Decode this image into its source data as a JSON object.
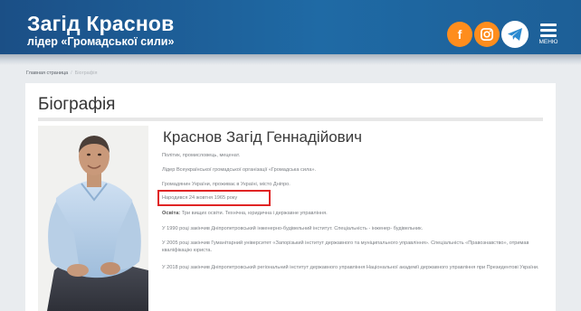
{
  "header": {
    "title": "Загід Краснов",
    "subtitle": "лідер «Громадської сили»",
    "social": {
      "facebook": "f"
    },
    "menu_label": "МЕНЮ"
  },
  "breadcrumb": {
    "home": "Главная страница",
    "separator": "/",
    "current": "Біографія"
  },
  "page": {
    "title": "Біографія",
    "person_name": "Краснов Загід Геннадійович",
    "paragraphs": {
      "p1": "Політик, промисловець, меценат.",
      "p2": "Лідер Всеукраїнської громадської організації «Громадська сила».",
      "p3": "Громадянин України, проживає в Україні, місто Дніпро.",
      "p4": "Народився 24 жовтня 1965 року",
      "p5_label": "Освіта:",
      "p5_text": " Три вищих освіти. Технічна, юридична і державне управління.",
      "p6": "У 1990 році закінчив Дніпропетровський інженерно-будівельний інститут. Спеціальність - інженер- будівельник.",
      "p7": "У 2005 році закінчив Гуманітарний університет «Запорізький інститут державного та муніципального управління». Спеціальність «Правознавство», отримав кваліфікацію юриста.",
      "p8": "У 2018 році закінчив Дніпропетровський регіональний інститут державного управління Національної академії державного управління при Президентові України."
    }
  },
  "colors": {
    "header_blue": "#1f6aa5",
    "social_orange": "#fe8d1d",
    "highlight_red": "#e02424"
  },
  "icons": {
    "facebook": "facebook-icon",
    "instagram": "instagram-icon",
    "telegram": "telegram-icon",
    "menu": "hamburger-menu-icon"
  }
}
